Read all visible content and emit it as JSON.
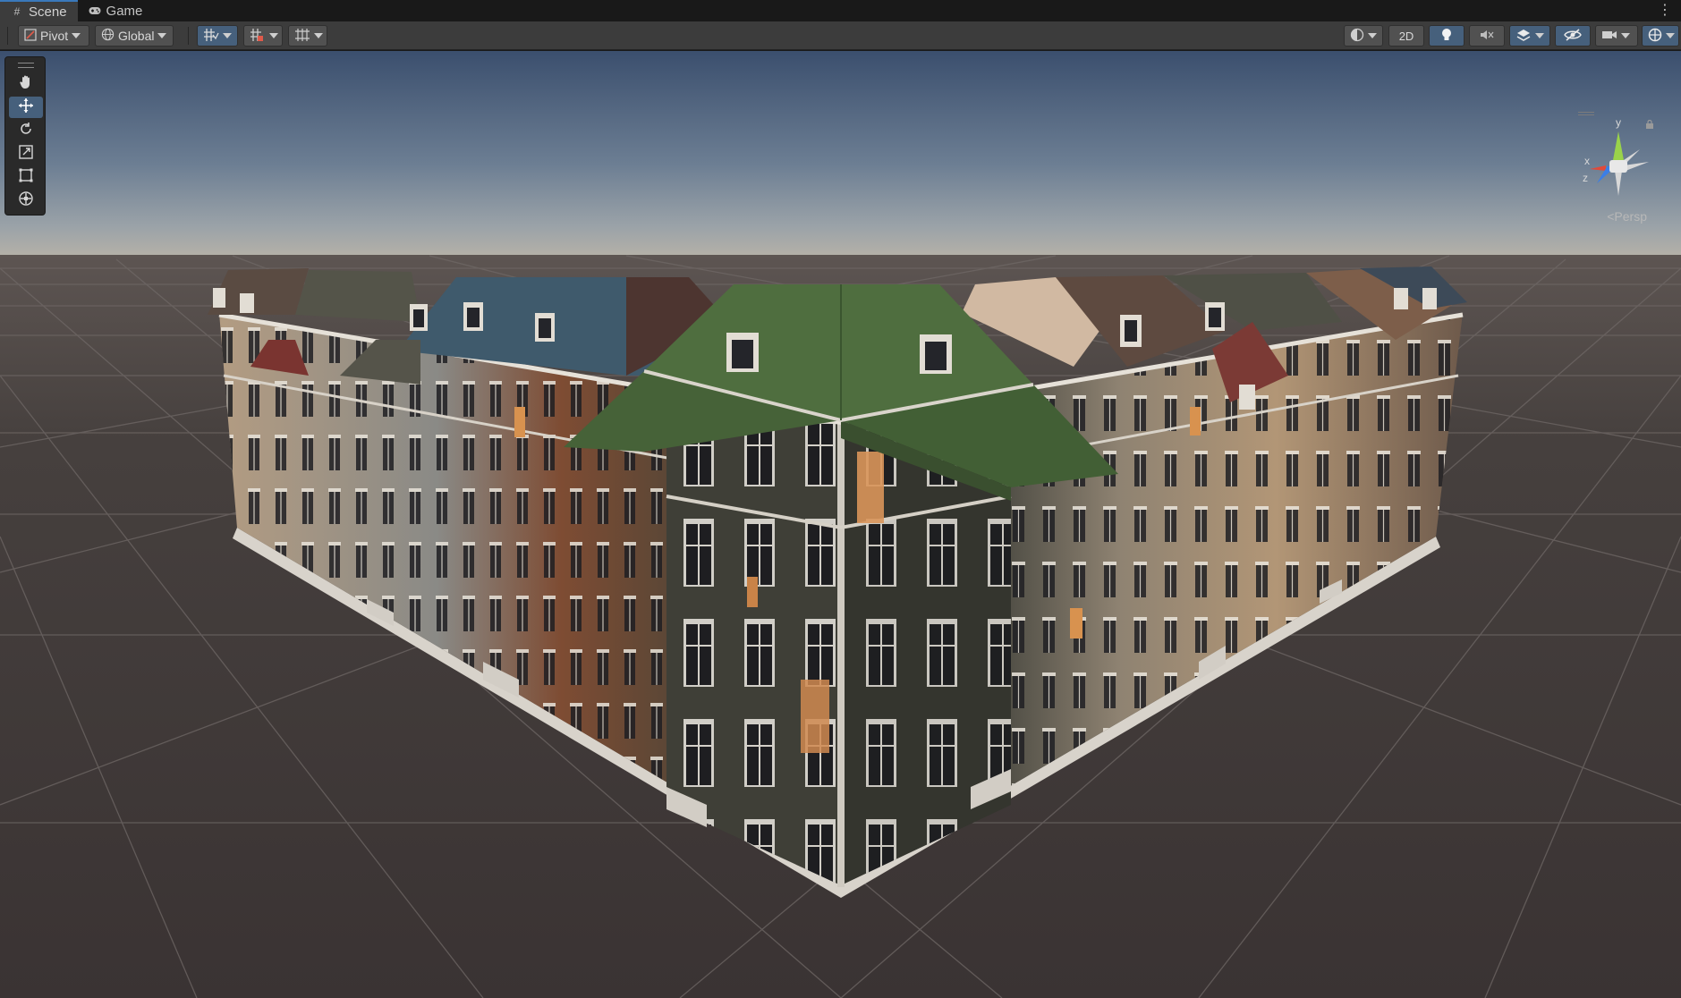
{
  "tabs": [
    {
      "label": "Scene",
      "icon": "grid-icon",
      "active": true
    },
    {
      "label": "Game",
      "icon": "gamepad-icon",
      "active": false
    }
  ],
  "toolbar": {
    "pivot_label": "Pivot",
    "global_label": "Global",
    "mode_2d_label": "2D"
  },
  "tool_palette": [
    "hand-tool",
    "move-tool",
    "rotate-tool",
    "scale-tool",
    "rect-tool",
    "transform-tool"
  ],
  "active_tool": "move-tool",
  "gizmo": {
    "y_label": "y",
    "x_label": "x",
    "z_label": "z",
    "projection_label": "Persp"
  },
  "colors": {
    "accent": "#46607c",
    "panel": "#3c3c3c",
    "tab_highlight": "#3a79bb"
  }
}
